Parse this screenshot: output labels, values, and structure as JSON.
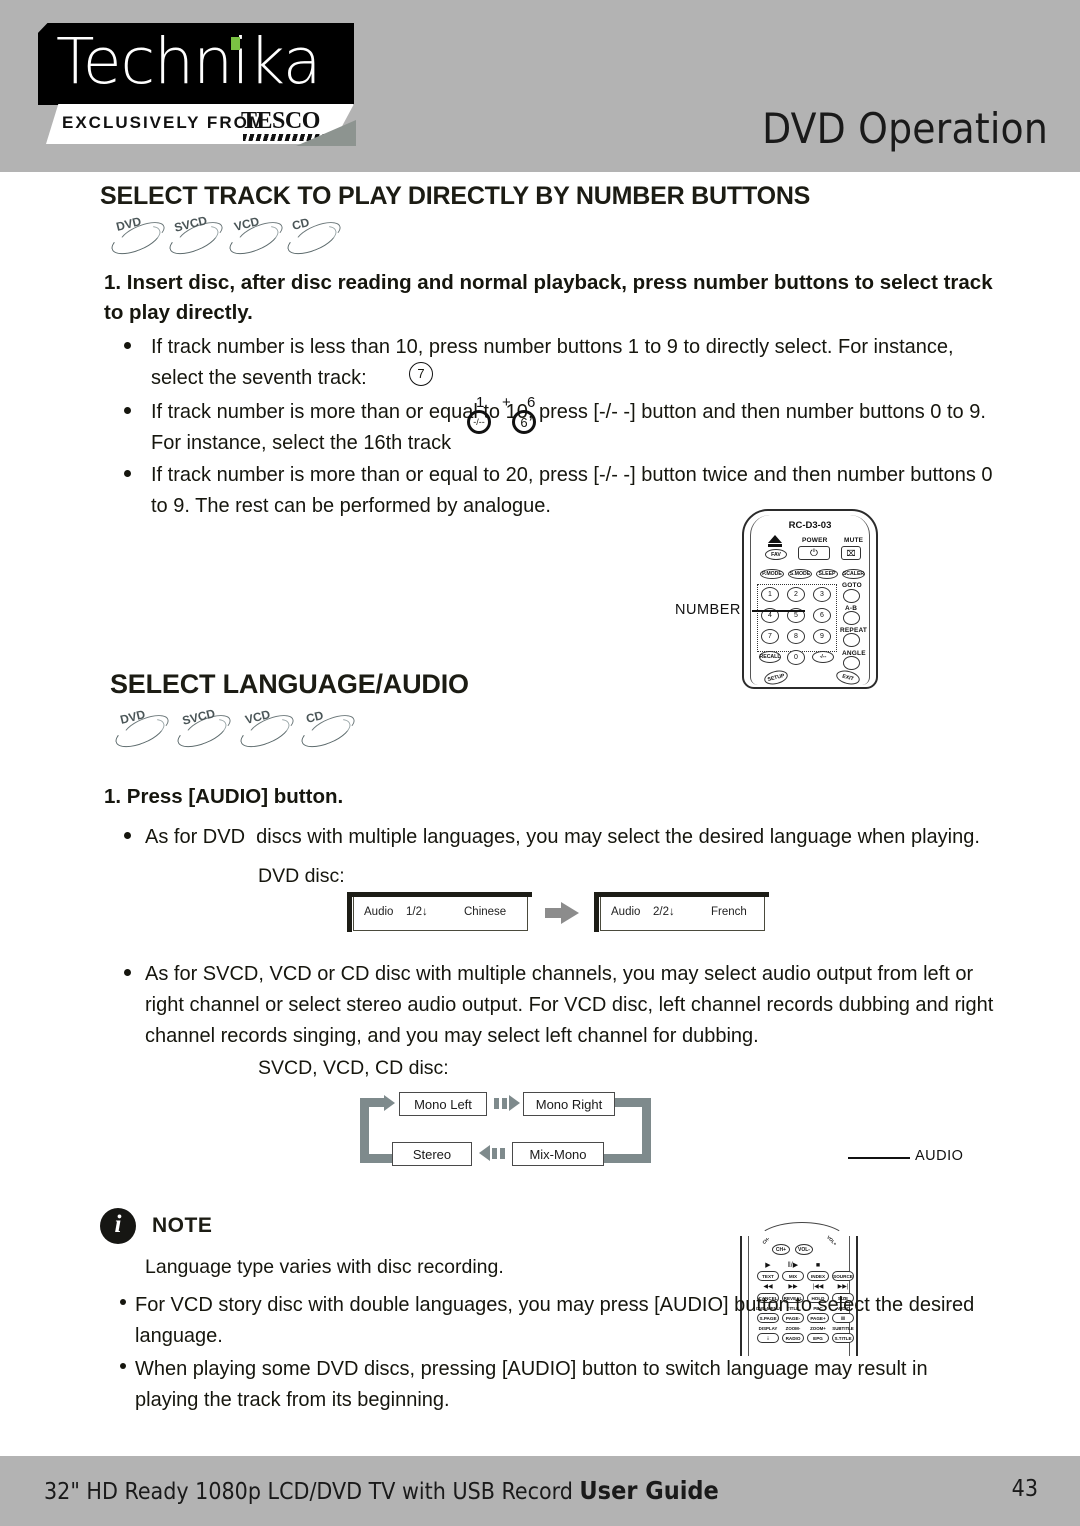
{
  "header": {
    "logo_word": "Technika",
    "logo_tagline": "EXCLUSIVELY FROM",
    "logo_brand": "TESCO",
    "title": "DVD Operation"
  },
  "section1": {
    "title": "SELECT TRACK TO PLAY DIRECTLY BY NUMBER BUTTONS",
    "discs": [
      "DVD",
      "SVCD",
      "VCD",
      "CD"
    ],
    "step1": "1. Insert disc, after disc reading and normal playback, press number buttons to select track to play directly.",
    "bullets": [
      "If track number is less than 10, press number buttons 1 to 9 to directly select. For instance, select the seventh track:",
      "If track number is more than or equal to 10, press [-/- -] button and then number buttons 0 to 9. For instance, select the 16th track",
      "If track number is more than or equal to 20, press [-/- -] button twice and then number buttons 0 to 9. The rest can be performed by analogue."
    ],
    "key_seven": "7",
    "key_dash": "-/--",
    "key_six": "6",
    "annot_one": "1",
    "annot_plus": "+",
    "annot_six": "6"
  },
  "remote1": {
    "model": "RC-D3-03",
    "callout": "NUMBER",
    "fav": "FAV",
    "power_label": "POWER",
    "mute_label": "MUTE",
    "power_glyph": "⏻",
    "mute_glyph": "⌧",
    "mode_row": [
      "P.MODE",
      "S.MODE",
      "SLEEP",
      "SCALER"
    ],
    "numbers": [
      "1",
      "2",
      "3",
      "4",
      "5",
      "6",
      "7",
      "8",
      "9"
    ],
    "recall": "RECALL",
    "zero": "0",
    "dashdash": "-/--",
    "right_labels": [
      "GOTO",
      "A-B",
      "REPEAT",
      "ANGLE"
    ],
    "setup": "SETUP",
    "exit": "EXIT"
  },
  "section2": {
    "title": "SELECT LANGUAGE/AUDIO",
    "discs": [
      "DVD",
      "SVCD",
      "VCD",
      "CD"
    ],
    "step1": "1. Press [AUDIO] button.",
    "bullet_dvd": "As for DVD  discs with multiple languages, you may select the desired language when playing.",
    "dvd_disc_label": "DVD disc:",
    "osd_left": {
      "field": "Audio",
      "index": "1/2↓",
      "value": "Chinese"
    },
    "osd_right": {
      "field": "Audio",
      "index": "2/2↓",
      "value": "French"
    },
    "bullet_svcd": "As for SVCD, VCD or CD disc with multiple channels, you may select audio output from left or right channel or select stereo audio output. For VCD disc, left channel records dubbing and right channel records singing, and you may select left channel for dubbing.",
    "svcd_disc_label": "SVCD, VCD, CD disc:",
    "cycle": [
      "Mono Left",
      "Mono Right",
      "Mix-Mono",
      "Stereo"
    ]
  },
  "remote2": {
    "callout": "AUDIO",
    "arc_labels": [
      "CH-",
      "CH+",
      "VOL-",
      "VOL+"
    ],
    "icon_row1": [
      "▶",
      "‖/▶",
      "■"
    ],
    "row1_buttons": [
      "TEXT",
      "MIX",
      "INDEX",
      "SOURCE"
    ],
    "icon_row2": [
      "◀◀",
      "▶▶",
      "|◀◀",
      "▶▶|"
    ],
    "row2_buttons": [
      "CANCEL",
      "REVEAL",
      "HOLD",
      "SIZE"
    ],
    "row3_labels": [
      "DVD-MENU",
      "TITLE",
      "PBC",
      "AUDIO"
    ],
    "row3_buttons": [
      "S.PAGE",
      "PAGE-",
      "PAGE+",
      "‖‖"
    ],
    "row4_labels": [
      "DISPLAY",
      "ZOOM-",
      "ZOOM+",
      "SUBTITLE"
    ],
    "row4_buttons": [
      "i",
      "RADIO",
      "EPG",
      "S.TITLE"
    ]
  },
  "note": {
    "icon": "i",
    "label": "NOTE",
    "body": "Language type varies with disc recording.",
    "bullets": [
      "For VCD story disc with double languages, you may press [AUDIO] button to select the desired language.",
      "When playing some DVD discs, pressing [AUDIO] button to switch language may result in playing the track from its beginning."
    ]
  },
  "footer": {
    "text_plain": "32\" HD Ready 1080p LCD/DVD TV with USB Record ",
    "text_bold": "User Guide",
    "page": "43"
  }
}
